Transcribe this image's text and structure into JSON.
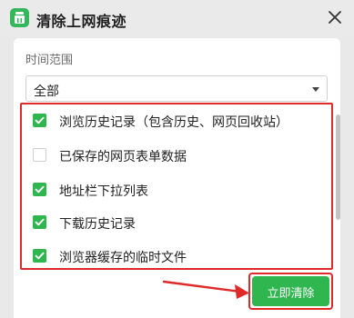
{
  "window": {
    "title": "清除上网痕迹",
    "app_icon": "broom-icon",
    "close_icon": "close-icon"
  },
  "time_range": {
    "label": "时间范围",
    "selected": "全部"
  },
  "options": [
    {
      "label": "浏览历史记录（包含历史、网页回收站）",
      "checked": true
    },
    {
      "label": "已保存的网页表单数据",
      "checked": false
    },
    {
      "label": "地址栏下拉列表",
      "checked": true
    },
    {
      "label": "下载历史记录",
      "checked": true
    },
    {
      "label": "浏览器缓存的临时文件",
      "checked": true
    }
  ],
  "action": {
    "clear_label": "立即清除"
  },
  "colors": {
    "accent": "#2fb64f",
    "highlight": "#e02a2a"
  }
}
